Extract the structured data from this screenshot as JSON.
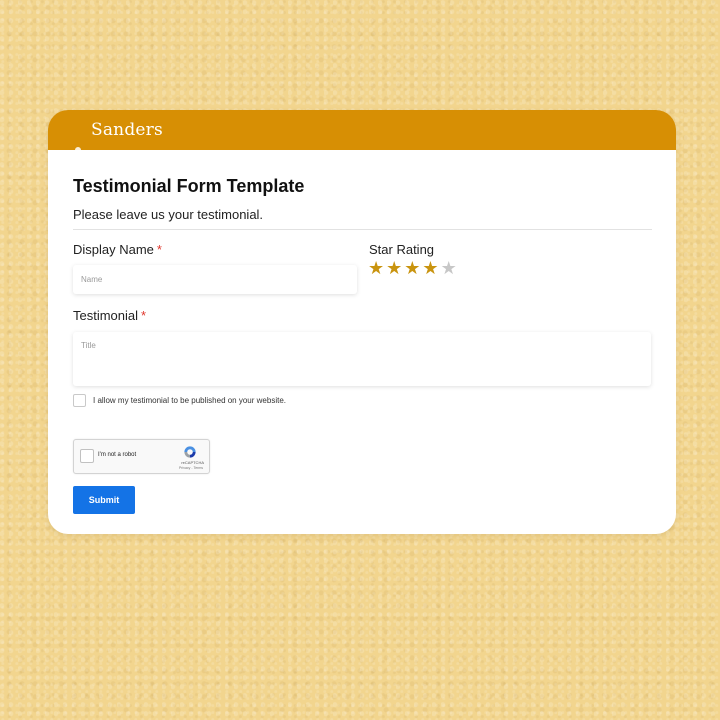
{
  "header": {
    "brand": "Sanders",
    "color": "#d78f04"
  },
  "form": {
    "title": "Testimonial Form Template",
    "subtitle": "Please leave us your testimonial."
  },
  "display_name": {
    "label": "Display Name",
    "required_mark": "*",
    "placeholder": "Name",
    "value": ""
  },
  "star_rating": {
    "label": "Star Rating",
    "value": 4,
    "max": 5,
    "star_glyph": "★",
    "color": "#c9940f"
  },
  "testimonial": {
    "label": "Testimonial",
    "required_mark": "*",
    "placeholder": "Title",
    "value": ""
  },
  "consent": {
    "label": "I allow my testimonial to be published on your website.",
    "checked": false
  },
  "recaptcha": {
    "label": "I'm not a robot",
    "brand": "reCAPTCHA",
    "terms": "Privacy - Terms",
    "checked": false
  },
  "submit": {
    "label": "Submit",
    "color": "#1473e6"
  },
  "background": {
    "color": "#f2d58e"
  }
}
